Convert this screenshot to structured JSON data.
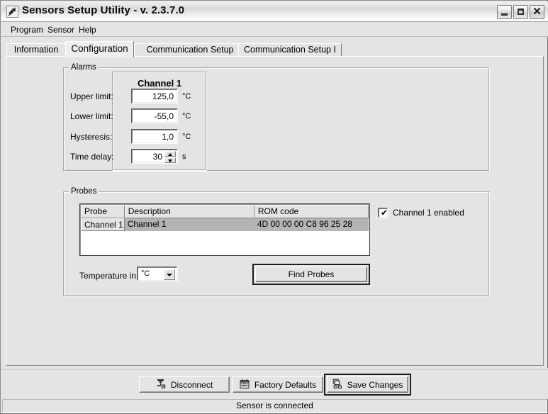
{
  "window": {
    "title": "Sensors Setup Utility - v. 2.3.7.0",
    "icon": "sensor-probe-icon",
    "minimize_label": "",
    "maximize_label": "",
    "close_label": "✕"
  },
  "menubar": {
    "items": [
      {
        "label": "Program"
      },
      {
        "label": "Sensor"
      },
      {
        "label": "Help"
      }
    ]
  },
  "tabs": {
    "items": [
      {
        "label": "Information",
        "selected": false
      },
      {
        "label": "Configuration",
        "selected": true
      },
      {
        "label": "Communication Setup",
        "selected": false
      },
      {
        "label": "Communication Setup I",
        "selected": false
      }
    ]
  },
  "alarms": {
    "group_title": "Alarms",
    "channel_title": "Channel 1",
    "rows": [
      {
        "label": "Upper limit:",
        "value": "125,0",
        "unit": "°C"
      },
      {
        "label": "Lower limit:",
        "value": "-55,0",
        "unit": "°C"
      },
      {
        "label": "Hysteresis:",
        "value": "1,0",
        "unit": "°C"
      },
      {
        "label": "Time delay:",
        "value": "30",
        "unit": "s"
      }
    ]
  },
  "probes": {
    "group_title": "Probes",
    "columns": [
      "Probe",
      "Description",
      "ROM code"
    ],
    "rows": [
      {
        "probe": "Channel 1",
        "description": "Channel 1",
        "rom_code": "4D 00 00 00 C8 96 25 28"
      }
    ],
    "checkbox": {
      "label": "Channel 1 enabled",
      "checked": true,
      "mark": "✔"
    },
    "temperature_label": "Temperature in:",
    "temperature_value": "°C",
    "find_probes_label": "Find Probes"
  },
  "footer": {
    "buttons": [
      {
        "label": "Disconnect",
        "icon": "disconnect-icon",
        "default": false
      },
      {
        "label": "Factory Defaults",
        "icon": "factory-defaults-icon",
        "default": false
      },
      {
        "label": "Save Changes",
        "icon": "save-changes-icon",
        "default": true
      }
    ],
    "status": "Sensor is connected"
  }
}
